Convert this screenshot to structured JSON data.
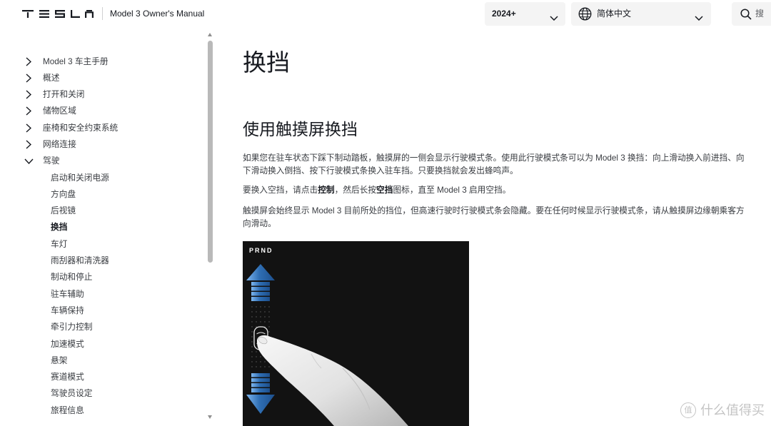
{
  "header": {
    "logo_text": "TESLA",
    "manual_title": "Model 3 Owner's Manual",
    "year_select": {
      "value": "2024+",
      "icon": "chevron-down-icon"
    },
    "language_select": {
      "value": "简体中文",
      "icon": "globe-icon",
      "dropdown_icon": "chevron-down-icon"
    },
    "search": {
      "placeholder": "搜",
      "icon": "search-icon"
    }
  },
  "sidebar": {
    "items": [
      {
        "label": "Model 3 车主手册",
        "icon": "chevron-right-icon"
      },
      {
        "label": "概述",
        "icon": "chevron-right-icon"
      },
      {
        "label": "打开和关闭",
        "icon": "chevron-right-icon"
      },
      {
        "label": "储物区域",
        "icon": "chevron-right-icon"
      },
      {
        "label": "座椅和安全约束系统",
        "icon": "chevron-right-icon"
      },
      {
        "label": "网络连接",
        "icon": "chevron-right-icon"
      },
      {
        "label": "驾驶",
        "icon": "chevron-down-icon",
        "expanded": true,
        "children": [
          {
            "label": "启动和关闭电源"
          },
          {
            "label": "方向盘"
          },
          {
            "label": "后视镜"
          },
          {
            "label": "换挡",
            "active": true
          },
          {
            "label": "车灯"
          },
          {
            "label": "雨刮器和清洗器"
          },
          {
            "label": "制动和停止"
          },
          {
            "label": "驻车辅助"
          },
          {
            "label": "车辆保持"
          },
          {
            "label": "牵引力控制"
          },
          {
            "label": "加速模式"
          },
          {
            "label": "悬架"
          },
          {
            "label": "赛道模式"
          },
          {
            "label": "驾驶员设定"
          },
          {
            "label": "旅程信息"
          }
        ]
      }
    ]
  },
  "main": {
    "title": "换挡",
    "section_title": "使用触摸屏换挡",
    "paragraph_1": "如果您在驻车状态下踩下制动踏板，触摸屏的一侧会显示行驶模式条。使用此行驶模式条可以为 Model 3 换挡：向上滑动换入前进挡、向下滑动换入倒挡、按下行驶模式条换入驻车挡。只要换挡就会发出蜂鸣声。",
    "paragraph_2": [
      "要换入空挡，请点击",
      "控制",
      "，然后长按",
      "空挡",
      "图标，直至 Model 3 启用空挡。"
    ],
    "paragraph_3": "触摸屏会始终显示 Model 3 目前所处的挡位，但高速行驶时行驶模式条会隐藏。要在任何时候显示行驶模式条，请从触摸屏边缘朝乘客方向滑动。",
    "figure": {
      "gear_indicator": "PRND"
    }
  },
  "watermark": {
    "badge": "值",
    "text": "什么值得买"
  },
  "colors": {
    "text_primary": "#171a20",
    "text_body": "#393c41",
    "dropdown_bg": "#f4f4f4",
    "figure_bg": "#121212",
    "arrow_blue": "#2f6fb5"
  }
}
